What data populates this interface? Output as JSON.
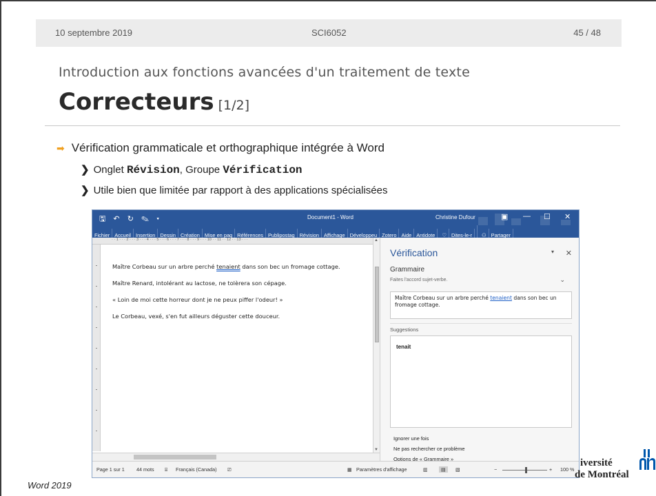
{
  "header": {
    "date": "10 septembre 2019",
    "course": "SCI6052",
    "page": "45 / 48"
  },
  "subtitle": "Introduction aux fonctions avancées d'un traitement de texte",
  "title": {
    "main": "Correcteurs",
    "suffix": "[1/2]"
  },
  "bullets": {
    "level1": "Vérification grammaticale et orthographique intégrée à Word",
    "onglet_prefix": "Onglet ",
    "onglet_name": "Révision",
    "groupe_prefix": ", Groupe ",
    "groupe_name": "Vérification",
    "utile": "Utile bien que limitée par rapport à des applications spécialisées"
  },
  "caption": "Word 2019",
  "logo": {
    "line1": "iversité",
    "line2": "de Montréal",
    "color": "#0057ac"
  },
  "word": {
    "doc_title": "Document1 - Word",
    "user": "Christine Dufour",
    "menus": [
      "Fichier",
      "Accueil",
      "Insertion",
      "Dessin",
      "Création",
      "Mise en pag",
      "Références",
      "Publipostag",
      "Révision",
      "Affichage",
      "Développeu",
      "Zotero",
      "Aide",
      "Antidote",
      "Dites-le-r",
      "Partager"
    ],
    "ruler_text": "· · 1 · · · 2 · · · 3 · · · 4 · · · 5 · · · 6 · · · 7 · · · 8 · · · 9 · · · 10 · · 11 · · 12 · · 13 · · ·",
    "doc_lines": {
      "l1_pre": "Maître Corbeau sur un arbre perché ",
      "l1_err": "tenaient",
      "l1_post": " dans son bec un fromage cottage.",
      "l2": "Maître Renard, intolérant au lactose, ne tolèrera son cépage.",
      "l3": "« Loin de moi cette horreur dont je ne peux piffer l'odeur! »",
      "l4": "Le Corbeau, vexé, s'en fut ailleurs déguster cette douceur."
    },
    "pane": {
      "title": "Vérification",
      "section": "Grammaire",
      "desc": "Faites l'accord sujet-verbe.",
      "context_pre": "Maître Corbeau sur un arbre perché ",
      "context_err": "tenaient",
      "context_post": " dans son bec un fromage cottage.",
      "suggestions_label": "Suggestions",
      "suggestion": "tenait",
      "act1": "Ignorer une fois",
      "act2": "Ne pas rechercher ce problème",
      "act3": "Options de « Grammaire »"
    },
    "status": {
      "page": "Page 1 sur 1",
      "words": "44 mots",
      "lang": "Français (Canada)",
      "display": "Paramètres d'affichage",
      "zoom": "100 %"
    },
    "accent": "#2b579a"
  }
}
